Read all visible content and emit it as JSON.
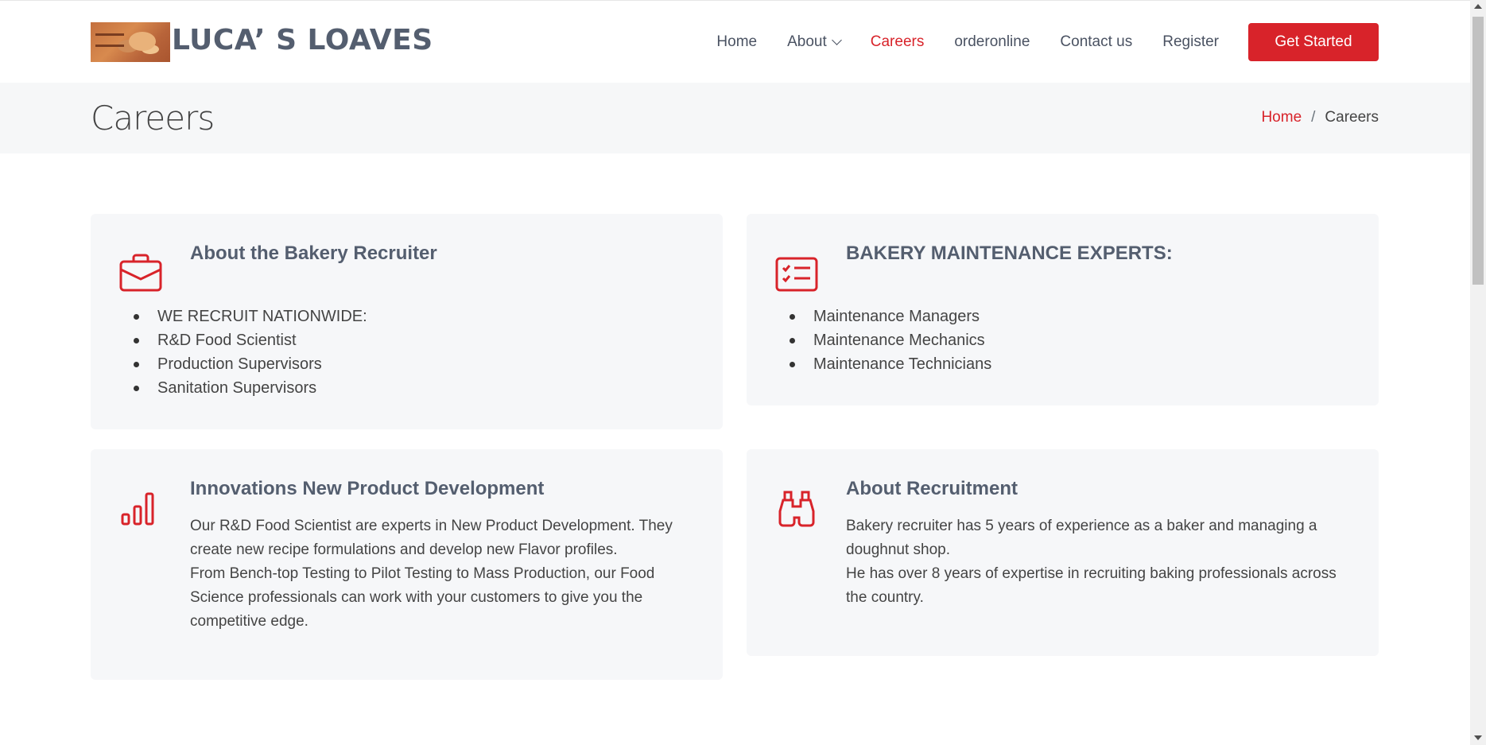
{
  "brand": {
    "name": "LUCA’ S LOAVES",
    "logo": "bakery-logo-image"
  },
  "nav": {
    "items": [
      {
        "label": "Home",
        "active": false
      },
      {
        "label": "About",
        "active": false,
        "dropdown": true
      },
      {
        "label": "Careers",
        "active": true
      },
      {
        "label": "orderonline",
        "active": false
      },
      {
        "label": "Contact us",
        "active": false
      },
      {
        "label": "Register",
        "active": false
      }
    ],
    "cta_label": "Get Started"
  },
  "breadcrumbs": {
    "title": "Careers",
    "home": "Home",
    "separator": "/",
    "current": "Careers"
  },
  "cards": [
    {
      "icon": "briefcase-icon",
      "title": "About the Bakery Recruiter",
      "items": [
        "WE RECRUIT NATIONWIDE:",
        "R&D Food Scientist",
        "Production Supervisors",
        "Sanitation Supervisors"
      ]
    },
    {
      "icon": "checklist-icon",
      "title": "BAKERY MAINTENANCE EXPERTS:",
      "items": [
        "Maintenance Managers",
        "Maintenance Mechanics",
        "Maintenance Technicians"
      ]
    },
    {
      "icon": "bar-chart-icon",
      "title": "Innovations New Product Development",
      "paragraphs": [
        "Our R&D Food Scientist are experts in New Product Development. They create new recipe formulations and develop new Flavor profiles.",
        "From Bench-top Testing to Pilot Testing to Mass Production, our Food Science professionals can work with your customers to give you the competitive edge."
      ]
    },
    {
      "icon": "binoculars-icon",
      "title": "About Recruitment",
      "paragraphs": [
        "Bakery recruiter has 5 years of experience as a baker and managing a doughnut shop.",
        "He has over 8 years of expertise in recruiting baking professionals across the country."
      ]
    }
  ],
  "colors": {
    "accent": "#d8232a",
    "heading": "#545e6f",
    "card_bg": "#f6f7f9",
    "bar_bg": "#f6f7f8"
  }
}
